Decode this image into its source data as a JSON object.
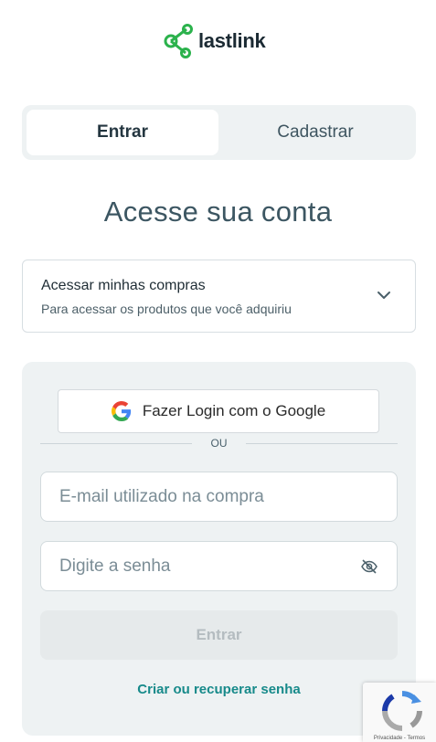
{
  "brand": {
    "name": "lastlink",
    "accent": "#2bb24c"
  },
  "tabs": [
    {
      "label": "Entrar",
      "active": true
    },
    {
      "label": "Cadastrar",
      "active": false
    }
  ],
  "heading": "Acesse sua conta",
  "access_select": {
    "title": "Acessar minhas compras",
    "subtitle": "Para acessar os produtos que você adquiriu",
    "icon": "chevron-down-icon"
  },
  "login": {
    "google_label": "Fazer Login com o Google",
    "divider": "OU",
    "email_placeholder": "E-mail utilizado na compra",
    "password_placeholder": "Digite a senha",
    "submit_label": "Entrar",
    "link_label": "Criar ou recuperar senha",
    "link_color": "#178a8a"
  },
  "recaptcha": {
    "text": "Privacidade - Termos"
  }
}
